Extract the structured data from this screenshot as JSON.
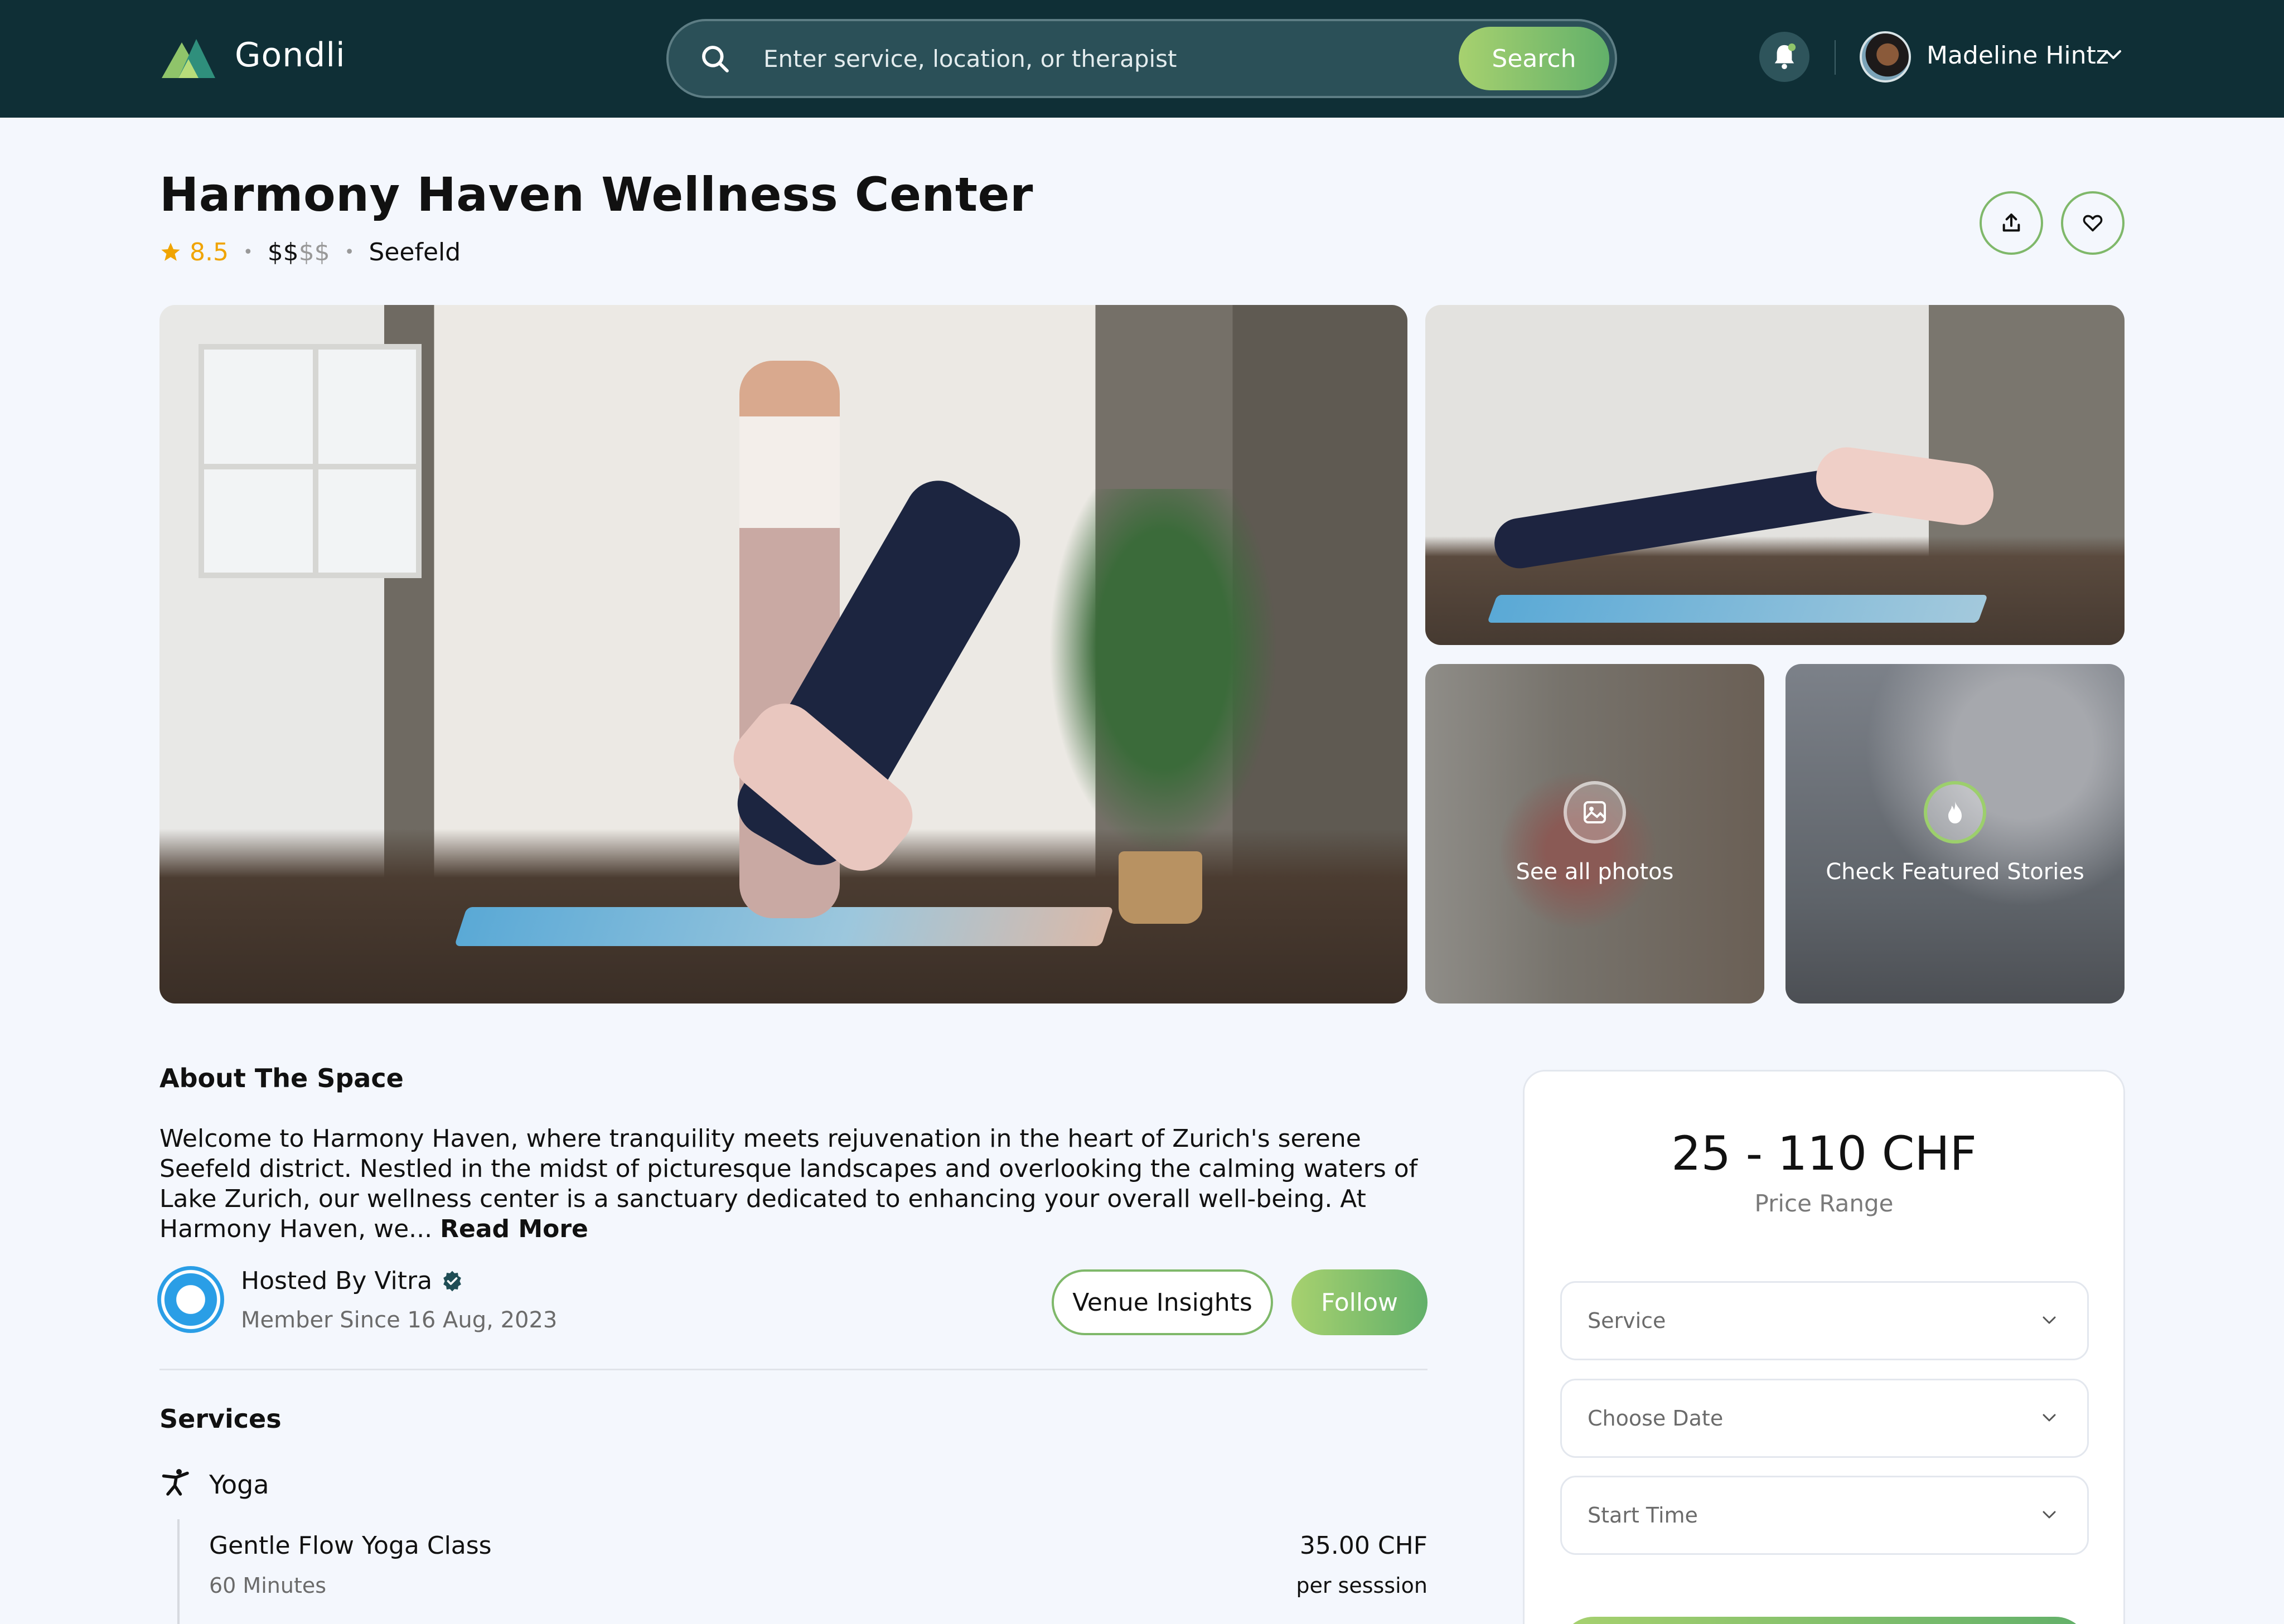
{
  "header": {
    "brand": "Gondli",
    "search": {
      "placeholder": "Enter service, location, or therapist",
      "button_label": "Search"
    },
    "user": {
      "name": "Madeline Hintz"
    }
  },
  "venue": {
    "title": "Harmony Haven Wellness Center",
    "rating": "8.5",
    "price_active": "$$",
    "price_inactive": "$$",
    "location": "Seefeld"
  },
  "gallery": {
    "see_all_label": "See all photos",
    "stories_label": "Check Featured Stories"
  },
  "about": {
    "title": "About The Space",
    "text": "Welcome to Harmony Haven, where tranquility meets rejuvenation in the heart of Zurich's serene Seefeld district. Nestled in the midst of picturesque landscapes and overlooking the calming waters of Lake Zurich, our wellness center is a sanctuary dedicated to enhancing your overall well-being. At Harmony Haven, we...",
    "read_more": "Read More"
  },
  "host": {
    "name": "Hosted By Vitra",
    "since": "Member Since 16 Aug, 2023",
    "insights_label": "Venue Insights",
    "follow_label": "Follow"
  },
  "services": {
    "title": "Services",
    "categories": [
      {
        "name": "Yoga",
        "icon": "yoga-pose-icon",
        "items": [
          {
            "name": "Gentle Flow Yoga Class",
            "duration": "60 Minutes",
            "price": "35.00 CHF",
            "unit": "per sesssion"
          }
        ]
      }
    ]
  },
  "booking": {
    "price_range": "25 - 110 CHF",
    "price_label": "Price Range",
    "selects": [
      "Service",
      "Choose Date",
      "Start Time"
    ]
  },
  "colors": {
    "header_bg": "#0f2f36",
    "accent_green_start": "#a7d16f",
    "accent_green_end": "#62b06a",
    "rating_star": "#f0a400",
    "page_bg": "#f4f7fd"
  }
}
